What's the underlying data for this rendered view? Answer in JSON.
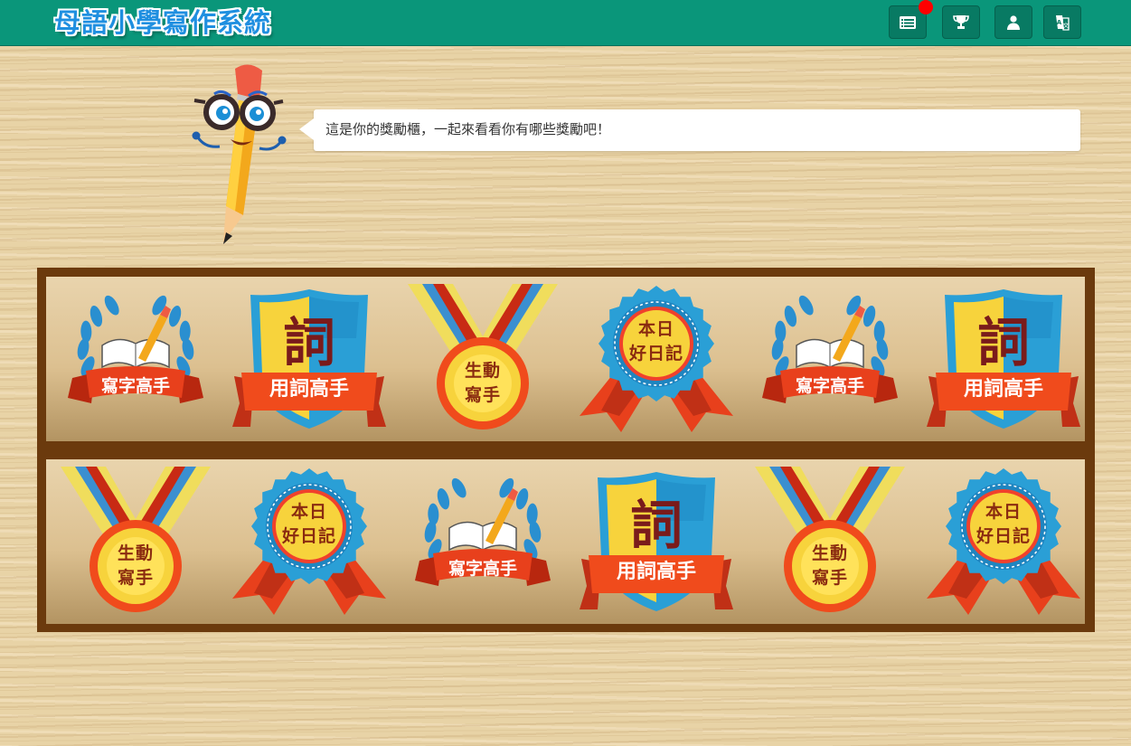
{
  "header": {
    "logo_text": "母語小學寫作系統",
    "buttons": [
      {
        "name": "messages-button",
        "icon": "list-icon",
        "has_notification": true
      },
      {
        "name": "awards-button",
        "icon": "trophy-icon"
      },
      {
        "name": "profile-button",
        "icon": "user-icon"
      },
      {
        "name": "language-button",
        "icon": "translate-book-icon"
      }
    ]
  },
  "mascot": {
    "speech": "這是你的獎勵櫃，一起來看看你有哪些獎勵吧！"
  },
  "shelves": [
    {
      "badges": [
        {
          "type": "laurel",
          "label": "寫字高手"
        },
        {
          "type": "shield",
          "label": "用詞高手",
          "char": "詞"
        },
        {
          "type": "medal",
          "label1": "生動",
          "label2": "寫手"
        },
        {
          "type": "rosette",
          "label1": "本日",
          "label2": "好日記"
        },
        {
          "type": "laurel",
          "label": "寫字高手"
        },
        {
          "type": "shield",
          "label": "用詞高手",
          "char": "詞"
        }
      ]
    },
    {
      "badges": [
        {
          "type": "medal",
          "label1": "生動",
          "label2": "寫手"
        },
        {
          "type": "rosette",
          "label1": "本日",
          "label2": "好日記"
        },
        {
          "type": "laurel",
          "label": "寫字高手"
        },
        {
          "type": "shield",
          "label": "用詞高手",
          "char": "詞"
        },
        {
          "type": "medal",
          "label1": "生動",
          "label2": "寫手"
        },
        {
          "type": "rosette",
          "label1": "本日",
          "label2": "好日記"
        }
      ]
    }
  ],
  "colors": {
    "topbar": "#0a967a",
    "button": "#087a63",
    "notification": "#ff0000",
    "cabinet_frame": "#6b3a0d",
    "ribbon_red": "#e8401c",
    "badge_blue": "#2a9fd6",
    "badge_yellow": "#f7d33c"
  }
}
